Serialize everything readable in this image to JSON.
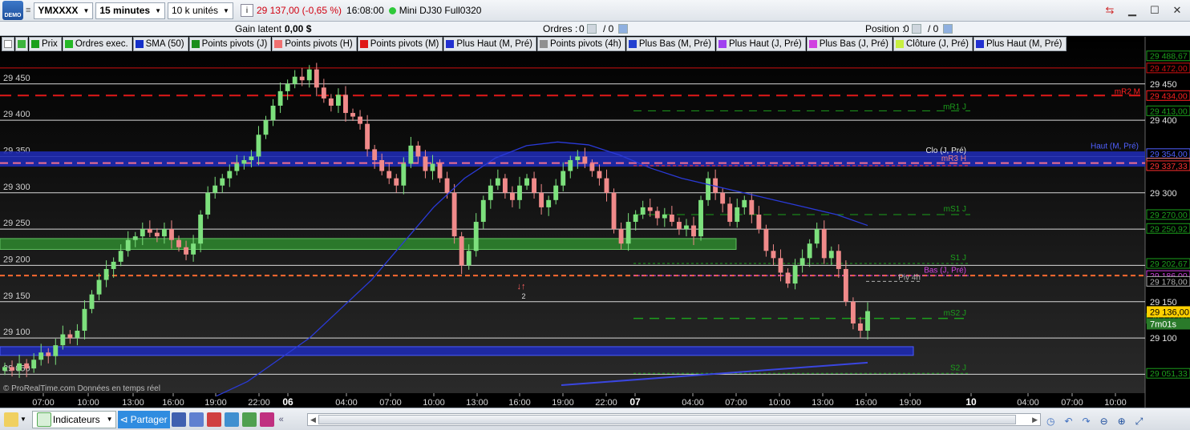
{
  "toolbar": {
    "logo_text": "DEMO",
    "instrument": "YMXXXX",
    "timeframe": "15 minutes",
    "units": "10 k unités",
    "last_price": "29 137,00 (-0,65 %)",
    "time": "16:08:00",
    "instrument_name": "Mini DJ30 Full0320"
  },
  "status_bar": {
    "gain_label": "Gain latent :",
    "gain_value": "0,00 $",
    "orders_label": "Ordres :",
    "orders_value": "0",
    "orders_total": "/ 0",
    "position_label": "Position :",
    "position_value": "0",
    "position_total": "/ 0"
  },
  "legend": [
    {
      "label": "Prix",
      "color": "#1aa01a"
    },
    {
      "label": "Ordres exec.",
      "color": "#26b826"
    },
    {
      "label": "SMA (50)",
      "color": "#1530c8"
    },
    {
      "label": "Points pivots (J)",
      "color": "#1c8f1c"
    },
    {
      "label": "Points pivots (H)",
      "color": "#f07070"
    },
    {
      "label": "Points pivots (M)",
      "color": "#e01818"
    },
    {
      "label": "Plus Haut (M, Pré)",
      "color": "#2230d0"
    },
    {
      "label": "Points pivots (4h)",
      "color": "#909090"
    },
    {
      "label": "Plus Bas (M, Pré)",
      "color": "#2240d0"
    },
    {
      "label": "Plus Haut (J, Pré)",
      "color": "#a040f0"
    },
    {
      "label": "Plus Bas (J, Pré)",
      "color": "#d040e0"
    },
    {
      "label": "Clôture (J, Pré)",
      "color": "#c8f040"
    },
    {
      "label": "Plus Haut (M, Pré)",
      "color": "#2230d0"
    }
  ],
  "chart_data": {
    "type": "candlestick",
    "ylim": [
      29035,
      29495
    ],
    "y_ticks": [
      "29 450",
      "29 400",
      "29 350",
      "29 300",
      "29 250",
      "29 200",
      "29 150",
      "29 100",
      "29 050"
    ],
    "y_tick_values": [
      29450,
      29400,
      29350,
      29300,
      29250,
      29200,
      29150,
      29100,
      29050
    ],
    "x_ticks": [
      "07:00",
      "10:00",
      "13:00",
      "16:00",
      "19:00",
      "22:00",
      "06",
      "04:00",
      "07:00",
      "10:00",
      "13:00",
      "16:00",
      "19:00",
      "22:00",
      "07",
      "04:00",
      "07:00",
      "10:00",
      "13:00",
      "16:00",
      "19:00",
      "10",
      "04:00",
      "07:00",
      "10:00"
    ],
    "x_tick_bold": [
      false,
      false,
      false,
      false,
      false,
      false,
      true,
      false,
      false,
      false,
      false,
      false,
      false,
      false,
      true,
      false,
      false,
      false,
      false,
      false,
      false,
      true,
      false,
      false,
      false
    ],
    "close_series": [
      29060,
      29055,
      29065,
      29058,
      29070,
      29080,
      29075,
      29090,
      29105,
      29100,
      29110,
      29140,
      29160,
      29180,
      29195,
      29205,
      29220,
      29235,
      29240,
      29250,
      29245,
      29240,
      29250,
      29235,
      29225,
      29215,
      29230,
      29270,
      29300,
      29310,
      29320,
      29330,
      29340,
      29345,
      29350,
      29380,
      29400,
      29420,
      29440,
      29450,
      29460,
      29455,
      29470,
      29445,
      29430,
      29420,
      29435,
      29410,
      29405,
      29395,
      29360,
      29345,
      29330,
      29320,
      29310,
      29340,
      29365,
      29350,
      29330,
      29340,
      29320,
      29300,
      29240,
      29200,
      29220,
      29260,
      29290,
      29310,
      29320,
      29300,
      29290,
      29310,
      29320,
      29300,
      29280,
      29290,
      29310,
      29330,
      29345,
      29350,
      29340,
      29330,
      29320,
      29300,
      29250,
      29230,
      29260,
      29270,
      29280,
      29275,
      29265,
      29270,
      29260,
      29250,
      29255,
      29240,
      29290,
      29320,
      29300,
      29285,
      29260,
      29280,
      29290,
      29270,
      29250,
      29220,
      29210,
      29190,
      29175,
      29200,
      29210,
      29230,
      29250,
      29210,
      29220,
      29195,
      29150,
      29120,
      29110,
      29137
    ],
    "sma50": [
      29020,
      29040,
      29070,
      29100,
      29140,
      29180,
      29230,
      29280,
      29320,
      29348,
      29365,
      29370,
      29366,
      29352,
      29334,
      29320,
      29310,
      29300,
      29290,
      29280,
      29270,
      29255
    ],
    "levels": [
      {
        "label": "mR2 M",
        "value": 29434.0,
        "color": "#ff2020",
        "tag": "29 434,00"
      },
      {
        "label": "mR1 J",
        "value": 29413.0,
        "color": "#1c9f1c",
        "tag": "29 413,00"
      },
      {
        "label": "Haut (M, Pré)",
        "value": 29354.0,
        "color": "#5060ff",
        "tag": "29 354,00"
      },
      {
        "label": "Clo (J, Pré)",
        "value": 29354.0,
        "color": "#e8e8e8",
        "tag": ""
      },
      {
        "label": "mR3 H",
        "value": 29341.0,
        "color": "#f08080",
        "tag": "29 341,00"
      },
      {
        "label": "",
        "value": 29337.33,
        "color": "#ff3030",
        "tag": "29 337,33"
      },
      {
        "label": "mS1 J",
        "value": 29270.0,
        "color": "#1c9f1c",
        "tag": "29 270,00"
      },
      {
        "label": "",
        "value": 29250.92,
        "color": "#1c9f1c",
        "tag": "29 250,92"
      },
      {
        "label": "S1 J",
        "value": 29202.67,
        "color": "#1c9f1c",
        "tag": "29 202,67"
      },
      {
        "label": "Bas (J, Pré)",
        "value": 29186.0,
        "color": "#d040e0",
        "tag": "29 186,00"
      },
      {
        "label": "Piv 4h",
        "value": 29178.0,
        "color": "#b0b0b0",
        "tag": "29 178,00"
      },
      {
        "label": "mS2 J",
        "value": 29127.0,
        "color": "#1c9f1c",
        "tag": "29 127,00"
      },
      {
        "label": "S2 J",
        "value": 29051.33,
        "color": "#1c9f1c",
        "tag": "29 051,33"
      }
    ],
    "top_tags": [
      "29 488,67",
      "29 472,00"
    ],
    "current_price_tag": "29 136,00",
    "countdown": "7m01s",
    "marker_count": "2"
  },
  "watermark": "© ProRealTime.com  Données en temps réel",
  "bottom_bar": {
    "indicators_label": "Indicateurs",
    "share_label": "Partager"
  }
}
